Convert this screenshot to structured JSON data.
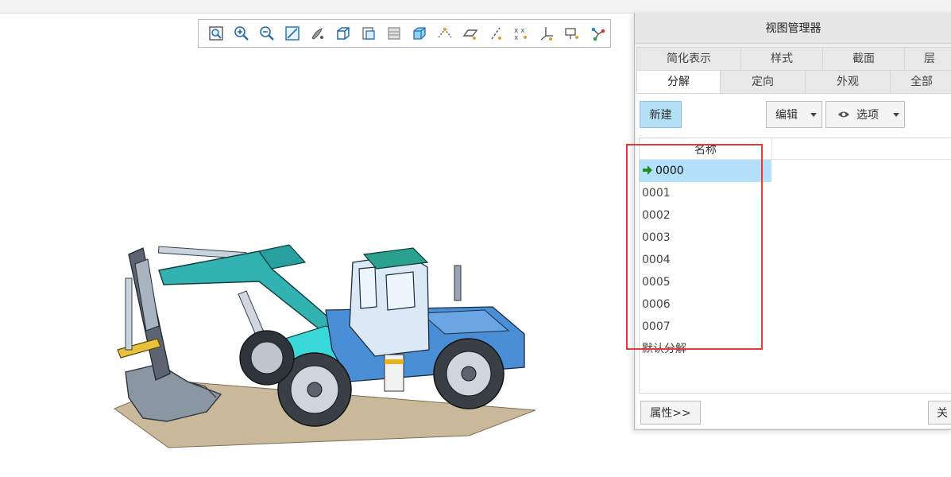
{
  "toolbar": {
    "icons": [
      "refit-icon",
      "zoom-in-icon",
      "zoom-out-icon",
      "repaint-icon",
      "display-style-icon",
      "saved-orientations-icon",
      "named-views-icon",
      "layers-icon",
      "view-manager-icon",
      "datum-display-icon",
      "plane-display-icon",
      "axis-display-icon",
      "point-display-icon",
      "csys-display-icon",
      "annotation-display-icon",
      "spin-center-icon"
    ]
  },
  "dialog": {
    "title": "视图管理器",
    "tabs_row1": [
      "简化表示",
      "样式",
      "截面",
      "层"
    ],
    "tabs_row2": [
      "分解",
      "定向",
      "外观",
      "全部"
    ],
    "active_tab": "分解",
    "buttons": {
      "new": "新建",
      "edit": "编辑",
      "options": "选项",
      "properties": "属性>>",
      "close": "关"
    },
    "list": {
      "column_header": "名称",
      "items": [
        "0000",
        "0001",
        "0002",
        "0003",
        "0004",
        "0005",
        "0006",
        "0007",
        "默认分解"
      ],
      "selected": "0000"
    },
    "colors": {
      "selected_row": "#b3e0fa",
      "highlight_box": "#e53939",
      "active_arrow": "#1e8c1e"
    }
  }
}
